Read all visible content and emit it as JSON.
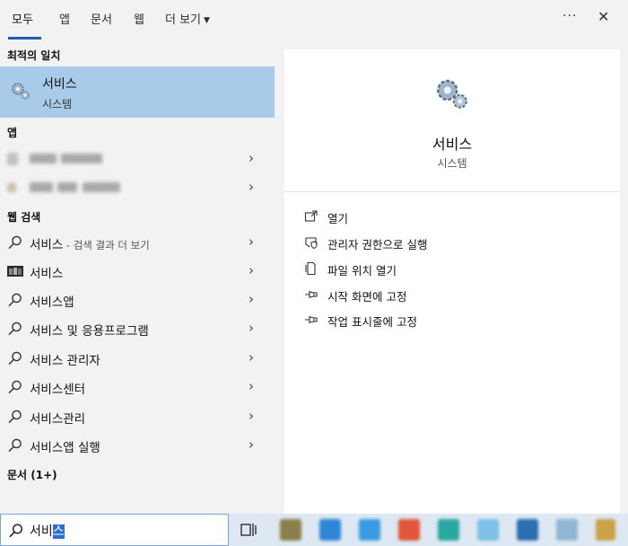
{
  "tabs": {
    "all": "모두",
    "apps": "앱",
    "documents": "문서",
    "web": "웹",
    "more": "더 보기"
  },
  "top_icons": {
    "more": "···",
    "close": "✕"
  },
  "sections": {
    "best_match": "최적의 일치",
    "apps": "앱",
    "web_search": "웹 검색",
    "documents": "문서 (1+)"
  },
  "best_match": {
    "name": "서비스",
    "type": "시스템",
    "icon": "services-gear-icon"
  },
  "web_results": [
    {
      "text": "서비스",
      "suffix": " - 검색 결과 더 보기",
      "icon": "search-icon"
    },
    {
      "text": "서비스",
      "suffix": "",
      "icon": "image-thumbnail-icon"
    },
    {
      "text": "서비스앱",
      "suffix": "",
      "icon": "search-icon"
    },
    {
      "text": "서비스 및 응용프로그램",
      "suffix": "",
      "icon": "search-icon"
    },
    {
      "text": "서비스 관리자",
      "suffix": "",
      "icon": "search-icon"
    },
    {
      "text": "서비스센터",
      "suffix": "",
      "icon": "search-icon"
    },
    {
      "text": "서비스관리",
      "suffix": "",
      "icon": "search-icon"
    },
    {
      "text": "서비스앱 실행",
      "suffix": "",
      "icon": "search-icon"
    }
  ],
  "preview": {
    "name": "서비스",
    "type": "시스템",
    "actions": [
      {
        "label": "열기",
        "icon": "open-icon"
      },
      {
        "label": "관리자 권한으로 실행",
        "icon": "shield-icon"
      },
      {
        "label": "파일 위치 열기",
        "icon": "file-location-icon"
      },
      {
        "label": "시작 화면에 고정",
        "icon": "pin-icon"
      },
      {
        "label": "작업 표시줄에 고정",
        "icon": "pin-icon"
      }
    ]
  },
  "search": {
    "typed": "서비",
    "composing": "스"
  },
  "colors": {
    "selected_bg": "#a9cbea",
    "accent": "#1f5ea8",
    "taskbar": "#dde8f2"
  }
}
